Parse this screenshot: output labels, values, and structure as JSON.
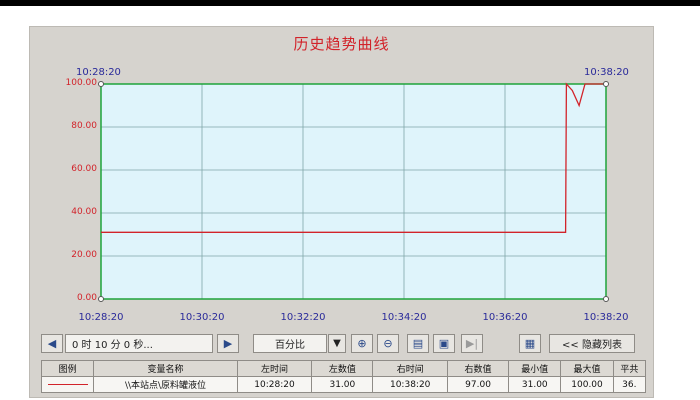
{
  "window": {
    "title": "历史趋势曲线"
  },
  "plot": {
    "start_time": "10:28:20",
    "end_time": "10:38:20",
    "background": "#dff4fb",
    "border_color": "#1fa33a",
    "grid_color": "#7fa6a8",
    "line_color": "#d2232a"
  },
  "chart_data": {
    "type": "line",
    "x": [
      "10:28:20",
      "10:30:20",
      "10:32:20",
      "10:34:20",
      "10:36:20",
      "10:37:32",
      "10:37:33",
      "10:37:40",
      "10:37:48",
      "10:37:55",
      "10:38:20"
    ],
    "series": [
      {
        "values": [
          31,
          31,
          31,
          31,
          31,
          31,
          100,
          97,
          90,
          100,
          100
        ]
      }
    ],
    "yticks": [
      "100.00",
      "80.00",
      "60.00",
      "40.00",
      "20.00",
      "0.00"
    ],
    "xticks": [
      "10:28:20",
      "10:30:20",
      "10:32:20",
      "10:34:20",
      "10:36:20",
      "10:38:20"
    ],
    "ylim": [
      0,
      100
    ],
    "grid": true
  },
  "toolbar": {
    "duration": "0 时 10 分 0 秒...",
    "percent": "百分比",
    "hide_list": "<< 隐藏列表"
  },
  "table": {
    "headers": [
      "图例",
      "变量名称",
      "左时间",
      "左数值",
      "右时间",
      "右数值",
      "最小值",
      "最大值",
      "平共"
    ],
    "rows": [
      [
        "",
        "\\\\本站点\\原料罐液位",
        "10:28:20",
        "31.00",
        "10:38:20",
        "97.00",
        "31.00",
        "100.00",
        "36."
      ]
    ]
  }
}
